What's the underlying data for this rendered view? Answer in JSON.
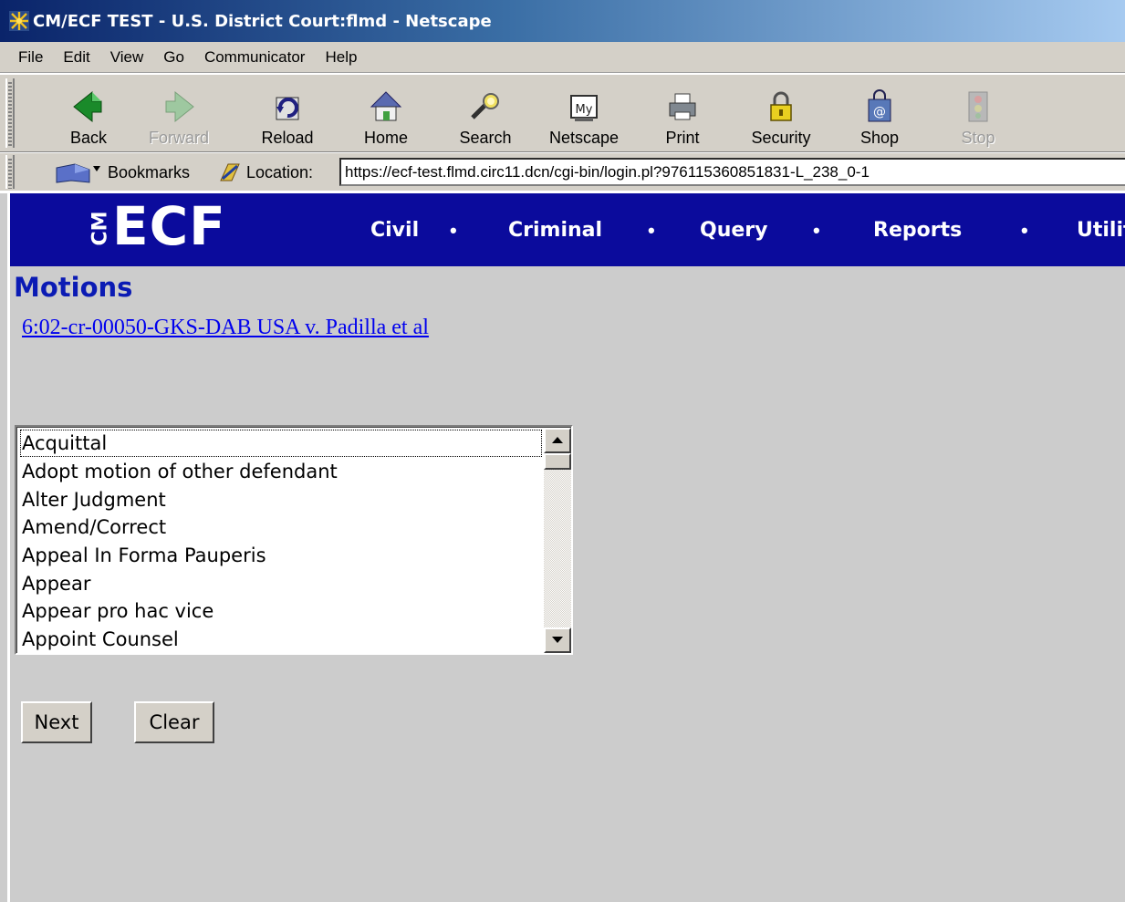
{
  "window": {
    "title": "CM/ECF TEST - U.S. District Court:flmd - Netscape"
  },
  "menu": {
    "items": [
      "File",
      "Edit",
      "View",
      "Go",
      "Communicator",
      "Help"
    ]
  },
  "toolbar": {
    "buttons": [
      {
        "label": "Back",
        "icon": "back-arrow-icon",
        "enabled": true
      },
      {
        "label": "Forward",
        "icon": "forward-arrow-icon",
        "enabled": false
      },
      {
        "label": "Reload",
        "icon": "reload-icon",
        "enabled": true
      },
      {
        "label": "Home",
        "icon": "home-icon",
        "enabled": true
      },
      {
        "label": "Search",
        "icon": "search-icon",
        "enabled": true
      },
      {
        "label": "Netscape",
        "icon": "my-netscape-icon",
        "enabled": true
      },
      {
        "label": "Print",
        "icon": "printer-icon",
        "enabled": true
      },
      {
        "label": "Security",
        "icon": "padlock-icon",
        "enabled": true
      },
      {
        "label": "Shop",
        "icon": "shop-bag-icon",
        "enabled": true
      },
      {
        "label": "Stop",
        "icon": "stop-icon",
        "enabled": false
      }
    ]
  },
  "location_bar": {
    "bookmarks_label": "Bookmarks",
    "location_label": "Location:",
    "url": "https://ecf-test.flmd.circ11.dcn/cgi-bin/login.pl?976115360851831-L_238_0-1"
  },
  "ecf": {
    "logo_text": "ECF",
    "logo_prefix": "CM",
    "nav": [
      "Civil",
      "Criminal",
      "Query",
      "Reports",
      "Utilit"
    ],
    "separator": "•"
  },
  "page": {
    "title": "Motions",
    "case_link": "6:02-cr-00050-GKS-DAB USA v. Padilla et al"
  },
  "motion_list": {
    "items": [
      "Acquittal",
      "Adopt motion of other defendant",
      "Alter Judgment",
      "Amend/Correct",
      "Appeal In Forma Pauperis",
      "Appear",
      "Appear pro hac vice",
      "Appoint Counsel"
    ]
  },
  "buttons": {
    "next": "Next",
    "clear": "Clear"
  },
  "colors": {
    "banner": "#0b0b9c",
    "title": "#0b1bb4",
    "link": "#0000ee",
    "background": "#cccccc",
    "chrome": "#d4d0c8"
  }
}
